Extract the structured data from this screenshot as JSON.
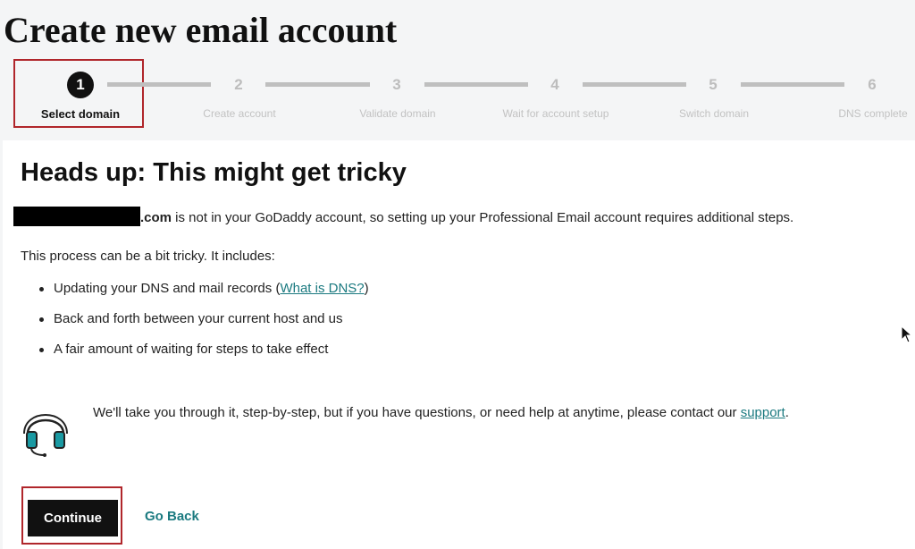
{
  "page": {
    "title": "Create new email account"
  },
  "stepper": {
    "current_step": 1,
    "steps": [
      {
        "number": "1",
        "label": "Select domain"
      },
      {
        "number": "2",
        "label": "Create account"
      },
      {
        "number": "3",
        "label": "Validate domain"
      },
      {
        "number": "4",
        "label": "Wait for account setup"
      },
      {
        "number": "5",
        "label": "Switch domain"
      },
      {
        "number": "6",
        "label": "DNS complete"
      }
    ]
  },
  "card": {
    "heading": "Heads up: This might get tricky",
    "intro_suffix": ".com",
    "intro_text": " is not in your GoDaddy account, so setting up your Professional Email account requires additional steps.",
    "tricky_text": "This process can be a bit tricky. It includes:",
    "bullets": {
      "dns_prefix": "Updating your DNS and mail records (",
      "dns_link": "What is DNS?",
      "dns_suffix": ")",
      "item2": "Back and forth between your current host and us",
      "item3": "A fair amount of waiting for steps to take effect"
    },
    "help_text": "We'll take you through it, step-by-step, but if you have questions, or need help at anytime, please contact our ",
    "support_link": "support",
    "help_end": "."
  },
  "actions": {
    "continue_label": "Continue",
    "go_back_label": "Go Back"
  },
  "colors": {
    "link": "#1b7a80",
    "highlight": "#b0262b",
    "active_step": "#111111",
    "inactive_step": "#bfbfbf"
  },
  "icons": {
    "support": "headset-icon",
    "cursor": "mouse-pointer-icon"
  }
}
